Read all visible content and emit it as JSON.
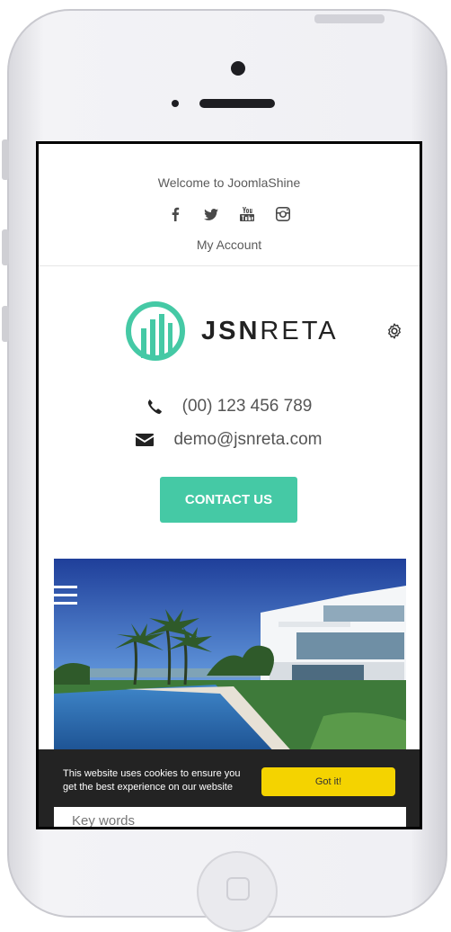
{
  "topbar": {
    "welcome": "Welcome to JoomlaShine",
    "social_icons": [
      "facebook-icon",
      "twitter-icon",
      "youtube-icon",
      "instagram-icon"
    ],
    "account_link": "My Account"
  },
  "brand": {
    "logo_bold": "JSN",
    "logo_light": "RETA",
    "accent_color": "#45c9a5"
  },
  "contact": {
    "phone": "(00) 123 456 789",
    "email": "demo@jsnreta.com",
    "button_label": "CONTACT US"
  },
  "cookie_banner": {
    "text": "This website uses cookies to ensure you get the best experience on our website",
    "button_label": "Got it!",
    "button_color": "#f4d300"
  },
  "search": {
    "placeholder": "Key words"
  }
}
